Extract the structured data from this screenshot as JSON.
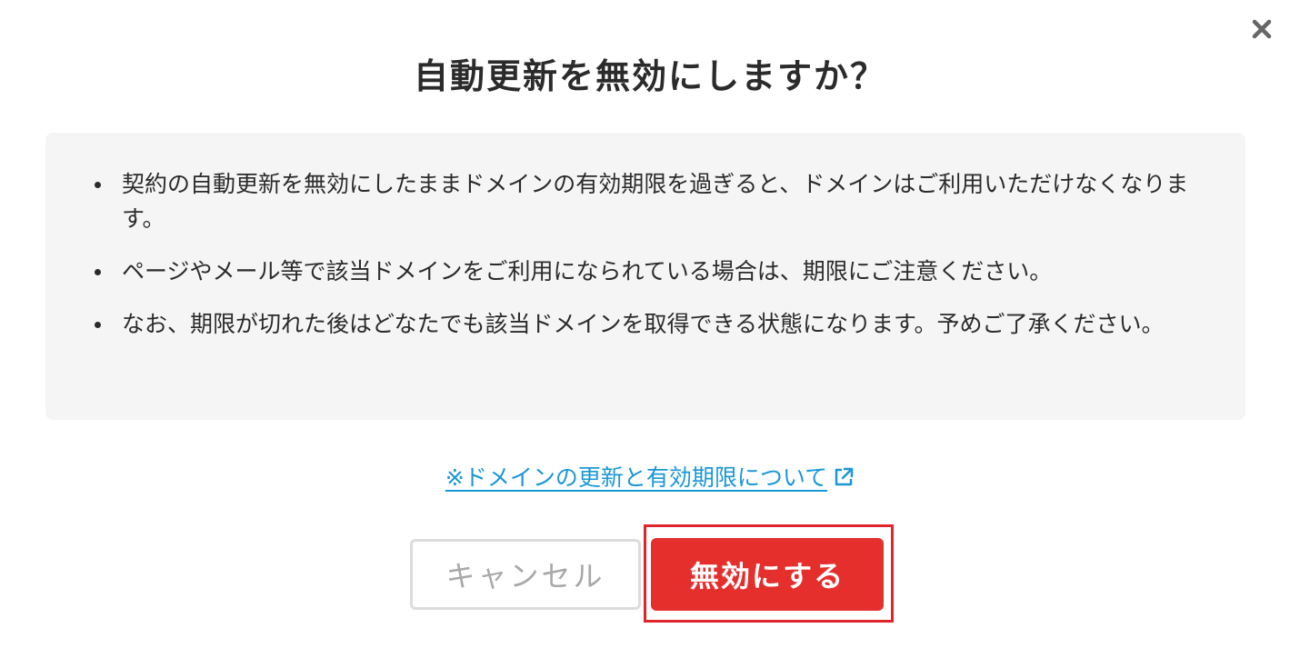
{
  "dialog": {
    "close_icon": "close-icon",
    "title": "自動更新を無効にしますか？"
  },
  "notice": {
    "items": [
      "契約の自動更新を無効にしたままドメインの有効期限を過ぎると、ドメインはご利用いただけなくなります。",
      "ページやメール等で該当ドメインをご利用になられている場合は、期限にご注意ください。",
      "なお、期限が切れた後はどなたでも該当ドメインを取得できる状態になります。予めご了承ください。"
    ]
  },
  "help_link": {
    "label": "※ドメインの更新と有効期限について",
    "icon": "external-link-icon",
    "color": "#1a97d6"
  },
  "actions": {
    "cancel_label": "キャンセル",
    "disable_label": "無効にする",
    "disable_color": "#e52f2d",
    "highlight_color": "#e0252a"
  }
}
